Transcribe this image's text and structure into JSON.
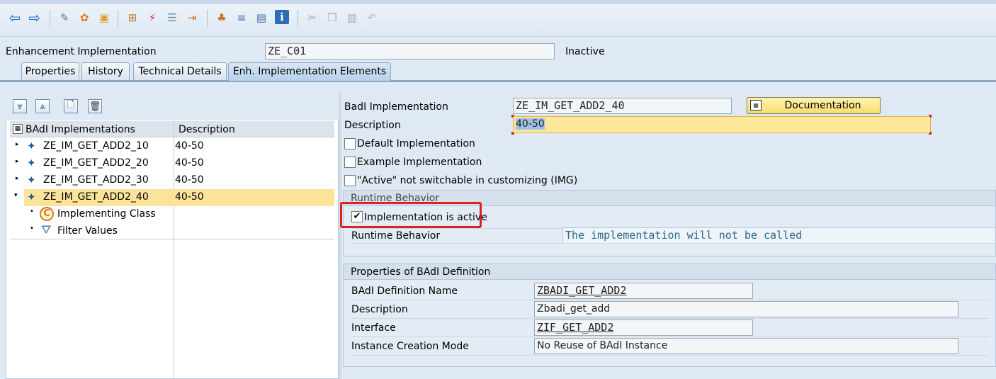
{
  "toolbar": {
    "icons": [
      "back-icon",
      "forward-icon",
      "display-change-icon",
      "activate-icon",
      "other-object-icon",
      "where-used-icon",
      "magic-wand-icon",
      "display-object-list-icon",
      "navigate-icon",
      "hierarchy-icon",
      "align-icon",
      "layout-icon",
      "info-icon",
      "cut-icon",
      "copy-icon",
      "paste-icon",
      "undo-icon"
    ]
  },
  "header": {
    "enh_impl_label": "Enhancement Implementation",
    "enh_impl_value": "ZE_C01",
    "status": "Inactive"
  },
  "tabs": [
    {
      "label": "Properties",
      "active": false
    },
    {
      "label": "History",
      "active": false
    },
    {
      "label": "Technical Details",
      "active": false
    },
    {
      "label": "Enh. Implementation Elements",
      "active": true
    }
  ],
  "tree": {
    "col_badi": "BAdI Implementations",
    "col_desc": "Description",
    "rows": [
      {
        "name": "ZE_IM_GET_ADD2_10",
        "desc": "40-50"
      },
      {
        "name": "ZE_IM_GET_ADD2_20",
        "desc": "40-50"
      },
      {
        "name": "ZE_IM_GET_ADD2_30",
        "desc": "40-50"
      },
      {
        "name": "ZE_IM_GET_ADD2_40",
        "desc": "40-50"
      }
    ],
    "children": [
      {
        "name": "Implementing Class"
      },
      {
        "name": "Filter Values"
      }
    ]
  },
  "detail": {
    "badi_impl_label": "BadI Implementation",
    "badi_impl_value": "ZE_IM_GET_ADD2_40",
    "doc_button": "Documentation",
    "desc_label": "Description",
    "desc_value": "40-50",
    "default_impl": "Default Implementation",
    "example_impl": "Example Implementation",
    "not_switchable": "\"Active\" not switchable in customizing (IMG)",
    "runtime_group": "Runtime Behavior",
    "impl_active": "Implementation is active",
    "impl_active_checked": true,
    "runtime_label": "Runtime Behavior",
    "runtime_value": "The implementation will not be called",
    "props_group": "Properties of BAdI Definition",
    "def_name_label": "BAdI Definition Name",
    "def_name_value": "ZBADI_GET_ADD2",
    "def_desc_label": "Description",
    "def_desc_value": "Zbadi_get_add",
    "interface_label": "Interface",
    "interface_value": "ZIF_GET_ADD2",
    "creation_label": "Instance Creation Mode",
    "creation_value": "No Reuse of BAdI Instance"
  },
  "colors": {
    "highlight_row": "#fbe49a",
    "required_field": "#fde899",
    "red_frame": "#e02020",
    "runtime_text": "#2a6a8a"
  }
}
